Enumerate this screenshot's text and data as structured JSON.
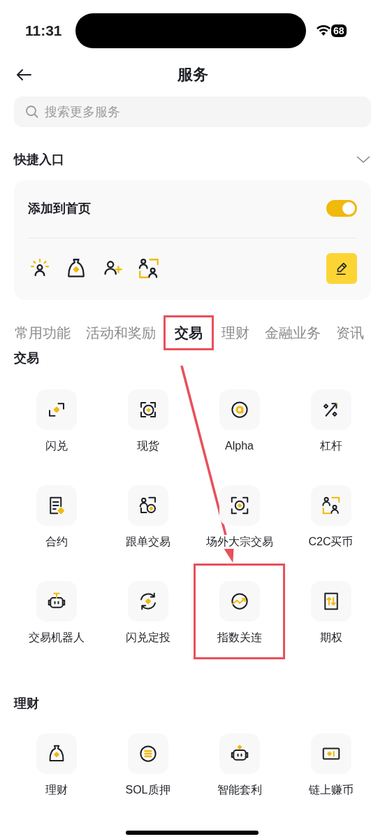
{
  "status_bar": {
    "time": "11:31",
    "battery": "68"
  },
  "header": {
    "title": "服务"
  },
  "search": {
    "placeholder": "搜索更多服务"
  },
  "quick_access": {
    "title": "快捷入口",
    "add_to_home": {
      "label": "添加到首页",
      "on": true
    }
  },
  "tabs": [
    {
      "label": "常用功能",
      "selected": false,
      "highlighted": false
    },
    {
      "label": "活动和奖励",
      "selected": false,
      "highlighted": false
    },
    {
      "label": "交易",
      "selected": true,
      "highlighted": true
    },
    {
      "label": "理财",
      "selected": false,
      "highlighted": false
    },
    {
      "label": "金融业务",
      "selected": false,
      "highlighted": false
    },
    {
      "label": "资讯",
      "selected": false,
      "highlighted": false
    }
  ],
  "sections": [
    {
      "title": "交易",
      "items": [
        {
          "label": "闪兑",
          "highlighted": false
        },
        {
          "label": "现货",
          "highlighted": false
        },
        {
          "label": "Alpha",
          "highlighted": false
        },
        {
          "label": "杠杆",
          "highlighted": false
        },
        {
          "label": "合约",
          "highlighted": false
        },
        {
          "label": "跟单交易",
          "highlighted": false
        },
        {
          "label": "场外大宗交易",
          "highlighted": false
        },
        {
          "label": "C2C买币",
          "highlighted": false
        },
        {
          "label": "交易机器人",
          "highlighted": false
        },
        {
          "label": "闪兑定投",
          "highlighted": false
        },
        {
          "label": "指数关连",
          "highlighted": true
        },
        {
          "label": "期权",
          "highlighted": false
        }
      ]
    },
    {
      "title": "理财",
      "items": [
        {
          "label": "理财",
          "highlighted": false
        },
        {
          "label": "SOL质押",
          "highlighted": false
        },
        {
          "label": "智能套利",
          "highlighted": false
        },
        {
          "label": "链上赚币",
          "highlighted": false
        }
      ]
    }
  ]
}
